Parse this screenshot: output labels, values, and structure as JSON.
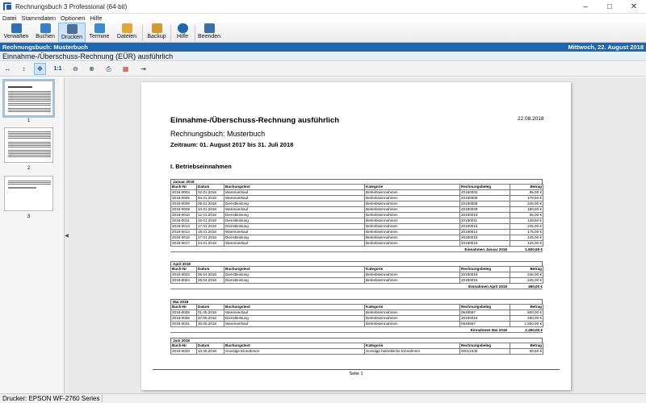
{
  "window": {
    "title": "Rechnungsbuch 3 Professional (64-bit)",
    "controls": [
      "minimize",
      "maximize",
      "close"
    ]
  },
  "menu": [
    "Datei",
    "Stammdaten",
    "Optionen",
    "Hilfe"
  ],
  "toolbar": {
    "buttons": [
      {
        "label": "Verwalten",
        "icon": "book-icon",
        "color": "#2f6fb3"
      },
      {
        "label": "Buchen",
        "icon": "pencil-book-icon",
        "color": "#3a7fc4"
      },
      {
        "label": "Drucken",
        "icon": "printer-icon",
        "color": "#4a6f99"
      },
      {
        "label": "Termine",
        "icon": "calendar-icon",
        "color": "#3b8bd1"
      },
      {
        "label": "Dateien",
        "icon": "folder-icon",
        "color": "#e2a63a"
      },
      {
        "label": "Backup",
        "icon": "backup-icon",
        "color": "#d49a2e"
      },
      {
        "label": "Hilfe",
        "icon": "help-icon",
        "color": "#1e66b0"
      },
      {
        "label": "Beenden",
        "icon": "exit-icon",
        "color": "#3a6ea8"
      }
    ]
  },
  "infobar": {
    "left": "Rechnungsbuch: Musterbuch",
    "right": "Mittwoch, 22. August 2018"
  },
  "report_header": "Einnahme-/Überschuss-Rechnung (EÜR) ausführlich",
  "preview_tools": [
    "fit-width-icon",
    "fit-height-icon",
    "fit-page-icon",
    "actual-size-icon",
    "zoom-out-icon",
    "zoom-in-icon",
    "print-icon",
    "pdf-export-icon",
    "exit-icon"
  ],
  "thumbnails": [
    {
      "num": "1",
      "selected": true
    },
    {
      "num": "2",
      "selected": false
    },
    {
      "num": "3",
      "selected": false
    }
  ],
  "document": {
    "title": "Einnahme-/Überschuss-Rechnung ausführlich",
    "date": "22.08.2018",
    "book": "Rechnungsbuch: Musterbuch",
    "period": "Zeitraum: 01. August 2017 bis 31. Juli 2018",
    "section": "I. Betriebseinnahmen",
    "columns": [
      "Buch-Nr",
      "Datum",
      "Buchungstext",
      "Kategorie",
      "Rechnungsbeleg",
      "Betrag"
    ],
    "months": [
      {
        "name": "Januar 2018",
        "rows": [
          [
            "2018-0003",
            "02.01.2018",
            "Warenverkauf",
            "Betriebseinnahmen",
            "20180003",
            "85,00 €"
          ],
          [
            "2018-0005",
            "04.01.2018",
            "Warenverkauf",
            "Betriebseinnahmen",
            "20180005",
            "178,50 €"
          ],
          [
            "2018-0008",
            "05.01.2018",
            "Dienstleistung",
            "Betriebseinnahmen",
            "20180008",
            "245,00 €"
          ],
          [
            "2018-0009",
            "10.01.2018",
            "Warenverkauf",
            "Betriebseinnahmen",
            "20180009",
            "180,00 €"
          ],
          [
            "2018-0010",
            "12.01.2018",
            "Dienstleistung",
            "Betriebseinnahmen",
            "20180010",
            "55,00 €"
          ],
          [
            "2018-0011",
            "15.01.2018",
            "Dienstleistung",
            "Betriebseinnahmen",
            "20180011",
            "148,50 €"
          ],
          [
            "2018-0013",
            "17.01.2018",
            "Dienstleistung",
            "Betriebseinnahmen",
            "20180016",
            "245,00 €"
          ],
          [
            "2018-0014",
            "18.01.2018",
            "Warenverkauf",
            "Betriebseinnahmen",
            "20180014",
            "175,00 €"
          ],
          [
            "2018-0016",
            "27.01.2018",
            "Dienstleistung",
            "Betriebseinnahmen",
            "20180016",
            "245,00 €"
          ],
          [
            "2018-0017",
            "24.01.2018",
            "Warenverkauf",
            "Betriebseinnahmen",
            "20180016",
            "125,00 €"
          ]
        ],
        "sum_label": "Einnahmen Januar 2018",
        "sum_value": "1.600,50 €"
      },
      {
        "name": "April 2018",
        "rows": [
          [
            "2018-0022",
            "06.04.2018",
            "Dienstleistung",
            "Betriebseinnahmen",
            "20180016",
            "245,00 €"
          ],
          [
            "2018-0024",
            "25.04.2018",
            "Dienstleistung",
            "Betriebseinnahmen",
            "20180016",
            "245,00 €"
          ]
        ],
        "sum_label": "Einnahmen April 2018",
        "sum_value": "490,00 €"
      },
      {
        "name": "Mai 2018",
        "rows": [
          [
            "2018-0026",
            "01.05.2018",
            "Warenverkauf",
            "Betriebseinnahmen",
            "0649567",
            "500,00 €"
          ],
          [
            "2018-0026",
            "27.05.2018",
            "Dienstleistung",
            "Betriebseinnahmen",
            "20180016",
            "450,00 €"
          ],
          [
            "2018-0031",
            "30.05.2018",
            "Warenverkauf",
            "Betriebseinnahmen",
            "0649567",
            "1.500,00 €"
          ]
        ],
        "sum_label": "Einnahmen Mai 2018",
        "sum_value": "2.450,00 €"
      },
      {
        "name": "Juni 2018",
        "rows": [
          [
            "2018-0033",
            "10.06.2018",
            "Sonstige Einnahmen",
            "Sonstige betriebliche Einnahmen",
            "00012345",
            "59,50 €"
          ]
        ],
        "sum_label": "",
        "sum_value": ""
      }
    ],
    "footer": "Seite 1"
  },
  "status": "Drucker: EPSON WF-2760 Series"
}
